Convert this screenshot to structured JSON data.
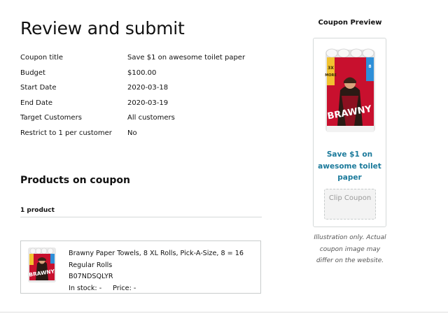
{
  "page": {
    "title": "Review and submit"
  },
  "details": [
    {
      "label": "Coupon title",
      "value": "Save $1 on awesome toilet paper"
    },
    {
      "label": "Budget",
      "value": "$100.00"
    },
    {
      "label": "Start Date",
      "value": "2020-03-18"
    },
    {
      "label": "End Date",
      "value": "2020-03-19"
    },
    {
      "label": "Target Customers",
      "value": "All customers"
    },
    {
      "label": "Restrict to 1 per customer",
      "value": "No"
    }
  ],
  "products": {
    "section_title": "Products on coupon",
    "count_label": "1 product",
    "items": [
      {
        "name": "Brawny Paper Towels, 8 XL Rolls, Pick-A-Size, 8 = 16 Regular Rolls",
        "asin": "B07NDSQLYR",
        "stock_label": "In stock: -",
        "price_label": "Price: -",
        "thumbnail_icon": "paper-towel-pack-image"
      }
    ]
  },
  "preview": {
    "title": "Coupon Preview",
    "image_icon": "paper-towel-pack-image",
    "coupon_text": "Save $1 on awesome toilet paper",
    "clip_button_label": "Clip Coupon",
    "note": "Illustration only. Actual coupon image may differ on the website."
  },
  "colors": {
    "coupon_text": "#1b7a9b",
    "brand_red": "#c8102e",
    "border": "#d5d9d9"
  }
}
